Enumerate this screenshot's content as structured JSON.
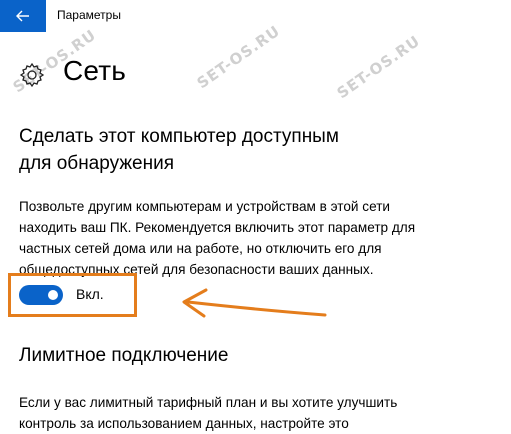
{
  "window": {
    "title": "Параметры"
  },
  "page": {
    "title": "Сеть"
  },
  "discovery": {
    "title": "Сделать этот компьютер доступным для обнаружения",
    "description": "Позвольте другим компьютерам и устройствам в этой сети находить ваш ПК. Рекомендуется включить этот параметр для частных сетей дома или на работе, но отключить его для общедоступных сетей для безопасности ваших данных.",
    "toggle_label": "Вкл.",
    "toggle_on": true
  },
  "metered": {
    "title": "Лимитное подключение",
    "description": "Если у вас лимитный тарифный план и вы хотите улучшить контроль за использованием данных, настройте это"
  },
  "watermarks": [
    "SET-OS.RU",
    "SET-OS.RU",
    "SET-OS.RU"
  ],
  "icons": {
    "back": "back-arrow-icon",
    "settings": "gear-icon",
    "annotation": "orange-arrow-icon"
  },
  "colors": {
    "accent": "#0a63c9",
    "annotation": "#e47d1c"
  }
}
